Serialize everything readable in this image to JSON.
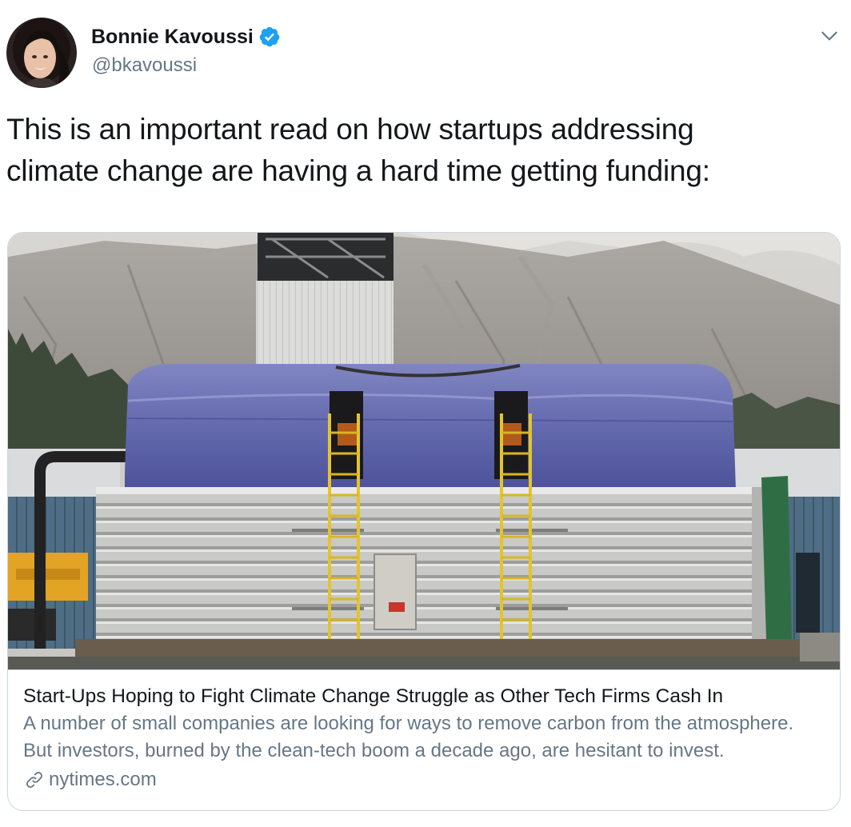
{
  "tweet": {
    "author": {
      "display_name": "Bonnie Kavoussi",
      "handle": "@bkavoussi",
      "verified": true,
      "verified_icon": "verified-badge-icon"
    },
    "more_icon": "chevron-down-icon",
    "text": "This is an important read on how startups addressing\nclimate change are having a hard time getting funding:",
    "card": {
      "image": "photo of a carbon capture facility with blue tarp and yellow ladders in front of granite cliffs",
      "title": "Start-Ups Hoping to Fight Climate Change Struggle as Other Tech Firms Cash In",
      "description": "A number of small companies are looking for ways to remove carbon from the atmosphere. But investors, burned by the clean-tech boom a decade ago, are hesitant to invest.",
      "link_icon": "link-icon",
      "domain": "nytimes.com"
    }
  },
  "colors": {
    "text_primary": "#14171a",
    "text_secondary": "#657786",
    "verified_blue": "#1da1f2",
    "border": "#ccd6dd"
  }
}
